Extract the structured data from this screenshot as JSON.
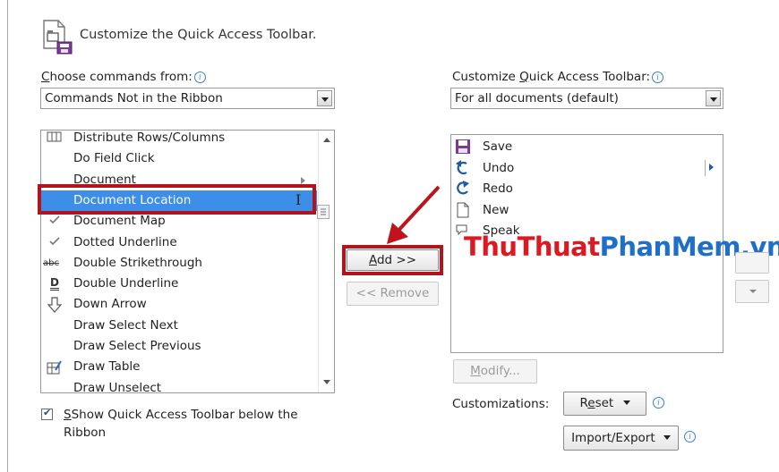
{
  "header": {
    "title": "Customize the Quick Access Toolbar."
  },
  "left": {
    "label_prefix": "C",
    "label_rest": "hoose commands from:",
    "combo_value": "Commands Not in the Ribbon",
    "commands": [
      {
        "label": "Distribute Rows/Columns",
        "icon": "table-grid-icon"
      },
      {
        "label": "Do Field Click",
        "icon": ""
      },
      {
        "label": "Document",
        "icon": "",
        "submenu": true
      },
      {
        "label": "Document Location",
        "icon": "",
        "selected": true
      },
      {
        "label": "Document Map",
        "icon": "check-icon"
      },
      {
        "label": "Dotted Underline",
        "icon": "check-icon"
      },
      {
        "label": "Double Strikethrough",
        "icon": "abc-strike-icon"
      },
      {
        "label": "Double Underline",
        "icon": "double-underline-icon"
      },
      {
        "label": "Down Arrow",
        "icon": "down-arrow-icon"
      },
      {
        "label": "Draw Select Next",
        "icon": ""
      },
      {
        "label": "Draw Select Previous",
        "icon": ""
      },
      {
        "label": "Draw Table",
        "icon": "draw-table-icon"
      },
      {
        "label": "Draw Unselect",
        "icon": ""
      }
    ],
    "show_toolbar_check": "Show Quick Access Toolbar below the",
    "show_toolbar_check_2": "Ribbon"
  },
  "middle": {
    "add_label": "Add >>",
    "remove_label": "<< Remove"
  },
  "right": {
    "label_part1": "Customize ",
    "label_ul": "Q",
    "label_part2": "uick Access Toolbar:",
    "combo_value": "For all documents (default)",
    "items": [
      {
        "label": "Save",
        "icon": "save-icon"
      },
      {
        "label": "Undo",
        "icon": "undo-icon"
      },
      {
        "label": "Redo",
        "icon": "redo-icon"
      },
      {
        "label": "New",
        "icon": "new-document-icon"
      },
      {
        "label": "Speak",
        "icon": "speak-icon"
      }
    ],
    "modify_label": "Modify...",
    "customizations_label": "Customizations:",
    "reset_label": "Reset",
    "import_export_label": "Import/Export"
  },
  "watermark": {
    "part1": "ThuThuat",
    "part2": "PhanMem",
    "part3": ".vn"
  },
  "colors": {
    "selection": "#3d8ee8",
    "highlight_border": "#b3141c",
    "watermark_red": "#d91a22",
    "watermark_blue": "#1f6fc8"
  }
}
